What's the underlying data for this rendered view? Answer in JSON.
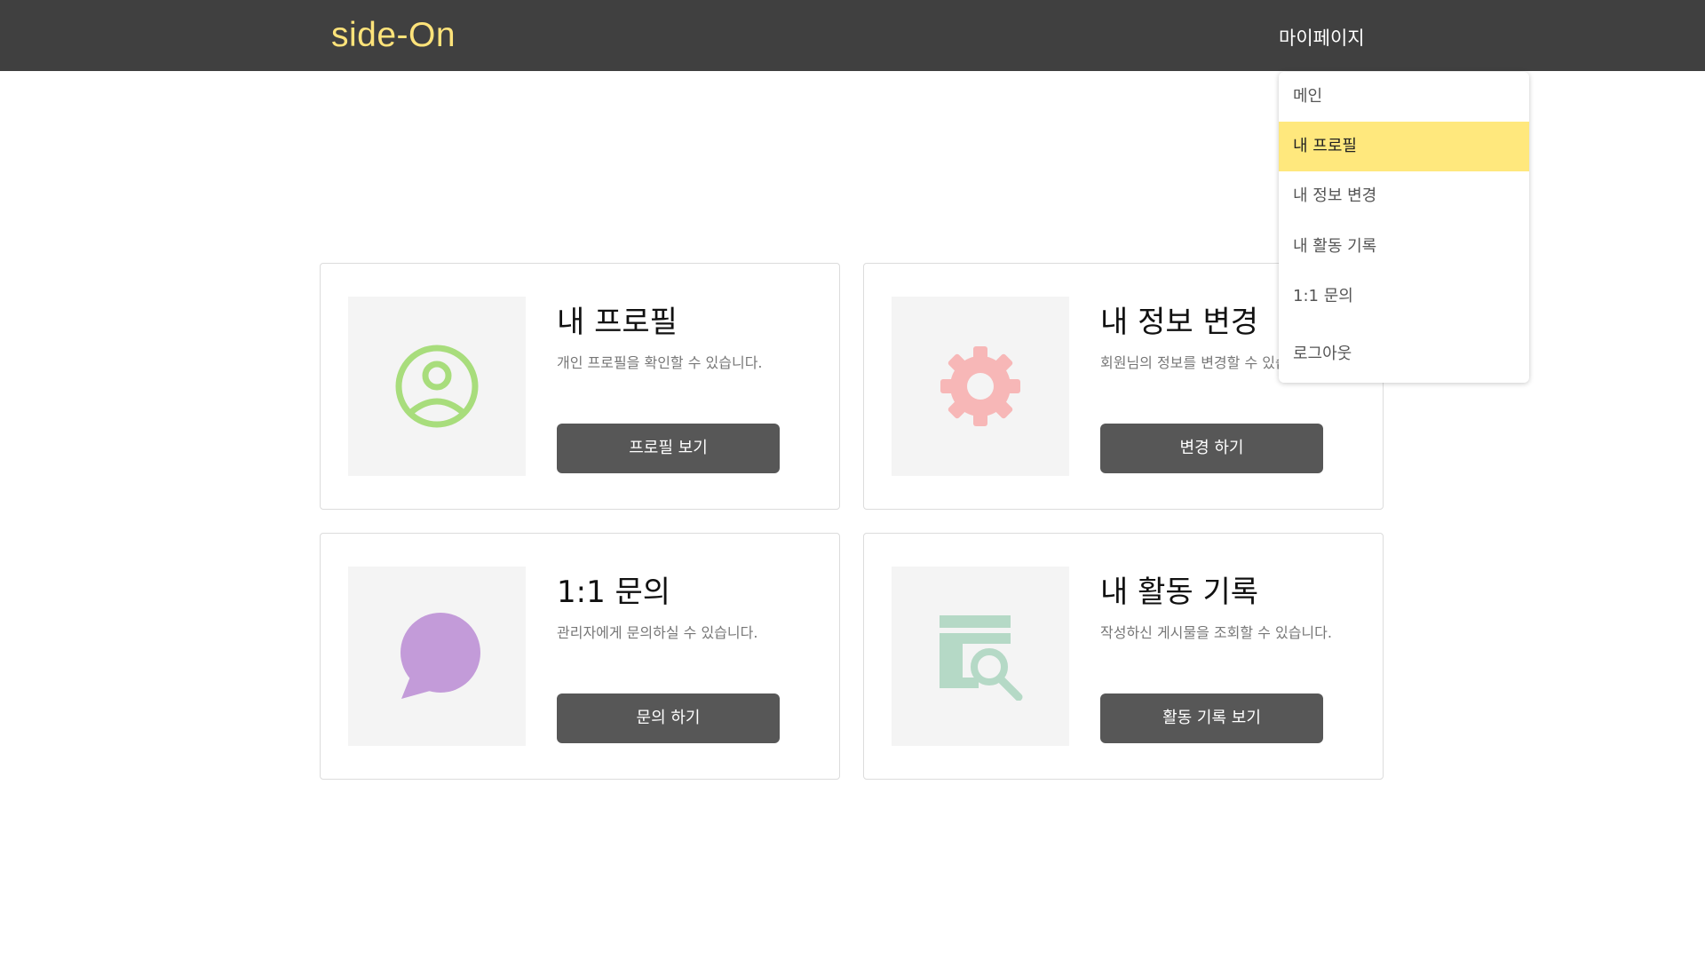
{
  "header": {
    "logo": "side-On",
    "menu_label": "마이페이지"
  },
  "dropdown": {
    "items": [
      {
        "label": "메인"
      },
      {
        "label": "내 프로필"
      },
      {
        "label": "내 정보 변경"
      },
      {
        "label": "내 활동 기록"
      },
      {
        "label": "1:1 문의"
      },
      {
        "label": "로그아웃"
      }
    ],
    "active_item": "내 프로필"
  },
  "cards": [
    {
      "title": "내 프로필",
      "description": "개인 프로필을 확인할 수 있습니다.",
      "button": "프로필 보기",
      "icon": "user-circle-icon",
      "icon_color": "#a8dd7c"
    },
    {
      "title": "내 정보 변경",
      "description": "회원님의 정보를 변경할 수 있습니다.",
      "button": "변경 하기",
      "icon": "gear-icon",
      "icon_color": "#f7b7b7"
    },
    {
      "title": "1:1 문의",
      "description": "관리자에게 문의하실 수 있습니다.",
      "button": "문의 하기",
      "icon": "chat-bubble-icon",
      "icon_color": "#c39bd9"
    },
    {
      "title": "내 활동 기록",
      "description": "작성하신 게시물을 조회할 수 있습니다.",
      "button": "활동 기록 보기",
      "icon": "document-search-icon",
      "icon_color": "#b5d9c6"
    }
  ],
  "colors": {
    "header_bg": "#404040",
    "logo": "#ffe37a",
    "highlight": "#ffe87d",
    "button_bg": "#575757"
  }
}
